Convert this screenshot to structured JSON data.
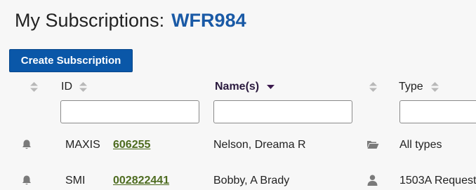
{
  "header": {
    "title": "My Subscriptions:",
    "account_code": "WFR984"
  },
  "actions": {
    "create_label": "Create Subscription"
  },
  "table": {
    "columns": {
      "id": "ID",
      "names": "Name(s)",
      "type": "Type"
    },
    "sorted_by": "names",
    "sort_direction": "descending",
    "filters": {
      "id": "",
      "names": "",
      "type": ""
    },
    "rows": [
      {
        "icon": "bell-icon",
        "source": "MAXIS",
        "id": "606255",
        "name": "Nelson, Dreama R",
        "type_icon": "folder-icon",
        "type": "All types"
      },
      {
        "icon": "bell-icon",
        "source": "SMI",
        "id": "002822441",
        "name": "Bobby, A Brady",
        "type_icon": "person-icon",
        "type": "1503A Request"
      }
    ]
  },
  "colors": {
    "accent": "#1a5aa6",
    "button": "#0a57a8",
    "link": "#4d6b1f",
    "sort_active": "#3c1a4e"
  }
}
